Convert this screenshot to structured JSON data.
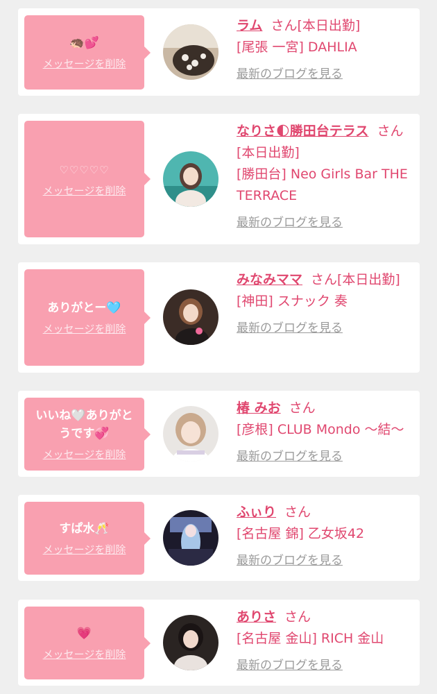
{
  "delete_label": "メッセージを削除",
  "blog_label": "最新のブログを見る",
  "colors": {
    "bubble": "#f9a0b0",
    "accent": "#e0476f",
    "muted": "#9a9a9a"
  },
  "items": [
    {
      "message": "🦔💕",
      "name": "ラム",
      "suffix": "さん[本日出勤]",
      "shop": "[尾張 一宮] DAHLIA"
    },
    {
      "message": "♡♡♡♡♡",
      "name": "なりさ🌓勝田台テラス",
      "suffix": "さん[本日出勤]",
      "shop": "[勝田台] Neo Girls Bar THE TERRACE"
    },
    {
      "message": "ありがとー🩵",
      "name": "みなみママ",
      "suffix": "さん[本日出勤]",
      "shop": "[神田] スナック 奏"
    },
    {
      "message": "いいね🤍ありがとうです💞",
      "name": "椿 みお",
      "suffix": "さん",
      "shop": "[彦根] CLUB Mondo 〜結〜"
    },
    {
      "message": "すぱ水🥂",
      "name": "ふぃり",
      "suffix": "さん",
      "shop": "[名古屋 錦] 乙女坂42"
    },
    {
      "message": "💗",
      "name": "ありさ",
      "suffix": "さん",
      "shop": "[名古屋 金山] RICH 金山"
    }
  ]
}
